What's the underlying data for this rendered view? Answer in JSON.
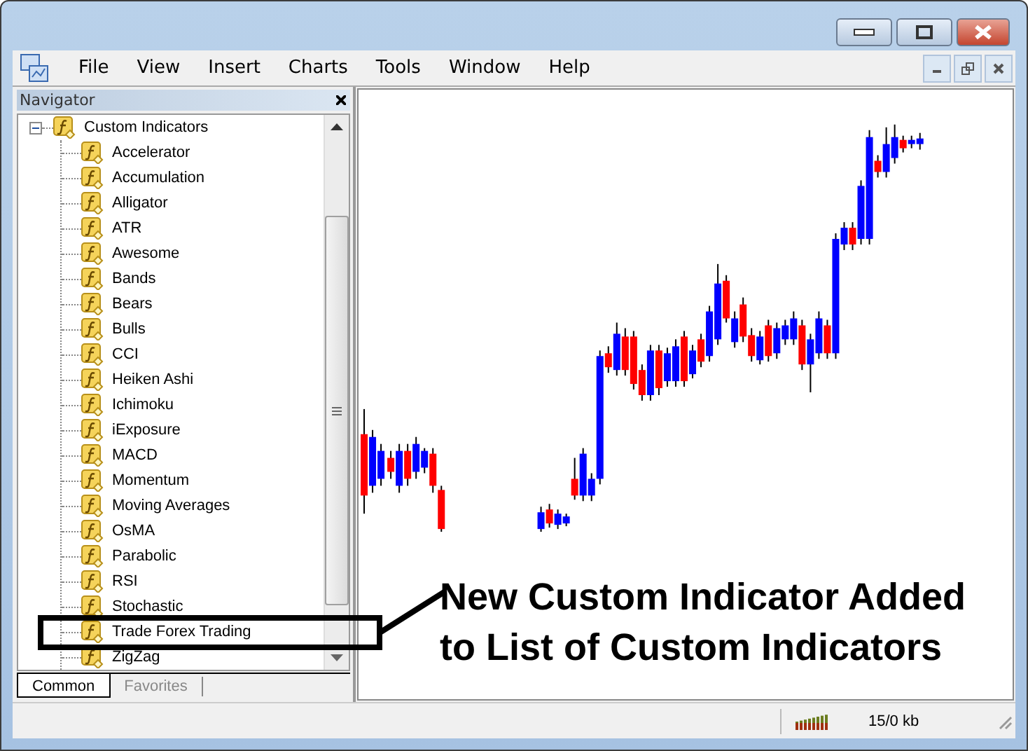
{
  "menu": [
    "File",
    "View",
    "Insert",
    "Charts",
    "Tools",
    "Window",
    "Help"
  ],
  "navigator": {
    "title": "Navigator",
    "tree": [
      {
        "label": "Custom Indicators",
        "expanded": true,
        "children": [
          {
            "label": "Accelerator"
          },
          {
            "label": "Accumulation"
          },
          {
            "label": "Alligator"
          },
          {
            "label": "ATR"
          },
          {
            "label": "Awesome"
          },
          {
            "label": "Bands"
          },
          {
            "label": "Bears"
          },
          {
            "label": "Bulls"
          },
          {
            "label": "CCI"
          },
          {
            "label": "Heiken Ashi"
          },
          {
            "label": "Ichimoku"
          },
          {
            "label": "iExposure"
          },
          {
            "label": "MACD"
          },
          {
            "label": "Momentum"
          },
          {
            "label": "Moving Averages"
          },
          {
            "label": "OsMA"
          },
          {
            "label": "Parabolic"
          },
          {
            "label": "RSI"
          },
          {
            "label": "Stochastic"
          },
          {
            "label": "Trade Forex Trading"
          },
          {
            "label": "ZigZag"
          }
        ]
      }
    ],
    "tabs": [
      {
        "label": "Common",
        "selected": true
      },
      {
        "label": "Favorites",
        "selected": false
      }
    ]
  },
  "annotation": {
    "lines": [
      "New Custom Indicator Added",
      "to List of Custom Indicators"
    ]
  },
  "status_bar": {
    "traffic": "15/0 kb"
  }
}
